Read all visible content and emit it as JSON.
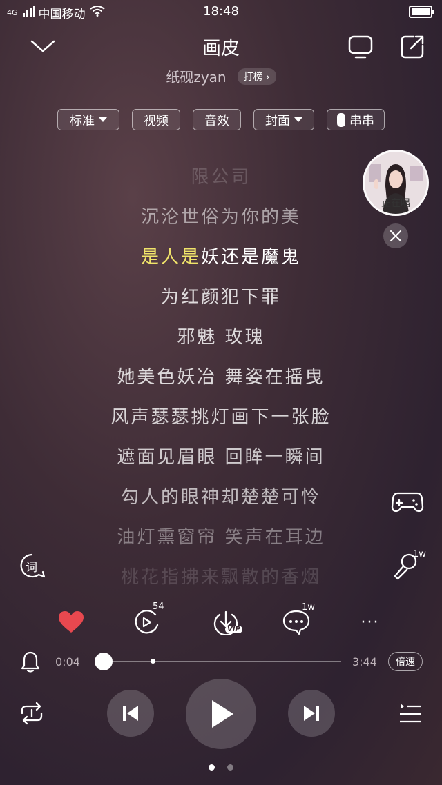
{
  "status_bar": {
    "network": "4G",
    "carrier": "中国移动",
    "time": "18:48"
  },
  "header": {
    "song_title": "画皮",
    "artist": "纸砚zyan",
    "rank_label": "打榜 ›"
  },
  "modes": {
    "standard": "标准",
    "video": "视频",
    "effects": "音效",
    "cover": "封面",
    "chuanchuan": "串串"
  },
  "lyrics": {
    "lines": [
      "限公司",
      "沉沦世俗为你的美",
      "是人是妖还是魔鬼",
      "为红颜犯下罪",
      "邪魅 玫瑰",
      "她美色妖冶 舞姿在摇曳",
      "风声瑟瑟挑灯画下一张脸",
      "遮面见眉眼 回眸一瞬间",
      "勾人的眼神却楚楚可怜",
      "油灯熏窗帘 笑声在耳边",
      "桃花指拂来飘散的香烟"
    ],
    "current_highlight": "是人是",
    "current_rest": "妖还是魔鬼"
  },
  "singer_bubble": {
    "label": "正在唱"
  },
  "side_icons": {
    "karaoke_count": "1w",
    "lyrics_label": "词"
  },
  "actions": {
    "mv_count": "54",
    "download_badge": "VIP",
    "comment_count": "1w",
    "more": "···"
  },
  "playback": {
    "elapsed": "0:04",
    "duration": "3:44",
    "speed_label": "倍速",
    "progress": 0.018
  },
  "pager": {
    "pages": 2,
    "active": 1
  },
  "colors": {
    "highlight": "#f0e46a",
    "like": "#e8484f"
  }
}
